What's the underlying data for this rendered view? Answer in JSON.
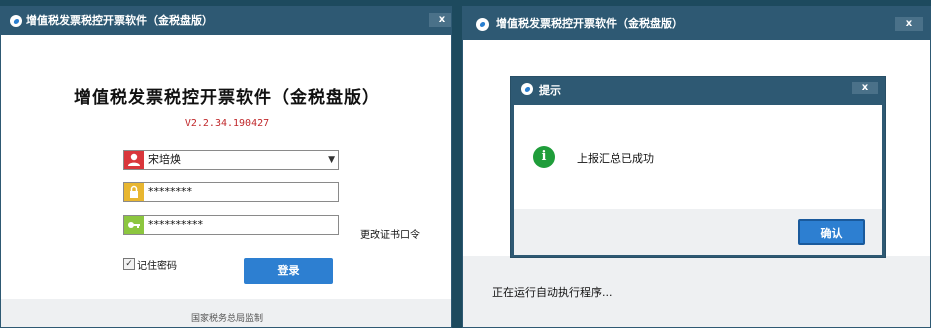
{
  "login_window": {
    "title": "增值税发票税控开票软件（金税盘版）",
    "close_label": "x",
    "app_title": "增值税发票税控开票软件（金税盘版）",
    "version": "V2.2.34.190427",
    "user_select": {
      "value": "宋培焕",
      "icon": "user-icon"
    },
    "password_field": {
      "value": "********",
      "icon": "lock-icon"
    },
    "cert_password_field": {
      "value": "**********",
      "icon": "key-icon"
    },
    "change_cert_link": "更改证书口令",
    "remember_password": {
      "label": "记住密码",
      "checked": true
    },
    "login_button": "登录",
    "footer": "国家税务总局监制"
  },
  "main_window": {
    "title": "增值税发票税控开票软件（金税盘版）",
    "close_label": "x",
    "status_text": "正在运行自动执行程序..."
  },
  "dialog": {
    "title": "提示",
    "close_label": "x",
    "message": "上报汇总已成功",
    "icon": "info-icon",
    "ok_button": "确认"
  },
  "colors": {
    "titlebar": "#2e5973",
    "button": "#2d7fd1",
    "version_text": "#c0282b",
    "info_icon": "#1f9d3a"
  }
}
